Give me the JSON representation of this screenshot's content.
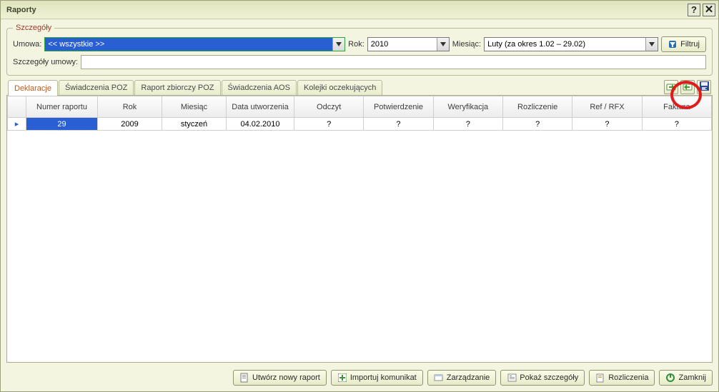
{
  "title": "Raporty",
  "fieldset": {
    "legend": "Szczegóły",
    "umowa_label": "Umowa:",
    "umowa_value": "<< wszystkie >>",
    "rok_label": "Rok:",
    "rok_value": "2010",
    "miesiac_label": "Miesiąc:",
    "miesiac_value": "Luty (za okres 1.02 – 29.02)",
    "filtruj": "Filtruj",
    "szczegoly_umowy_label": "Szczegóły umowy:",
    "szczegoly_umowy_value": ""
  },
  "tabs": {
    "t0": "Deklaracje",
    "t1": "Świadczenia POZ",
    "t2": "Raport zbiorczy POZ",
    "t3": "Świadczenia AOS",
    "t4": "Kolejki oczekujących"
  },
  "grid": {
    "h_numer": "Numer raportu",
    "h_rok": "Rok",
    "h_miesiac": "Miesiąc",
    "h_data": "Data utworzenia",
    "h_odczyt": "Odczyt",
    "h_potw": "Potwierdzenie",
    "h_wer": "Weryfikacja",
    "h_rozl": "Rozliczenie",
    "h_ref": "Ref / RFX",
    "h_faktura": "Faktura",
    "row0": {
      "numer": "29",
      "rok": "2009",
      "miesiac": "styczeń",
      "data": "04.02.2010",
      "odczyt": "?",
      "potw": "?",
      "wer": "?",
      "rozl": "?",
      "ref": "?",
      "faktura": "?"
    }
  },
  "buttons": {
    "utworz": "Utwórz nowy raport",
    "import": "Importuj komunikat",
    "zarzadzanie": "Zarządzanie",
    "szczegoly": "Pokaż szczegóły",
    "rozliczenia": "Rozliczenia",
    "zamknij": "Zamknij"
  }
}
